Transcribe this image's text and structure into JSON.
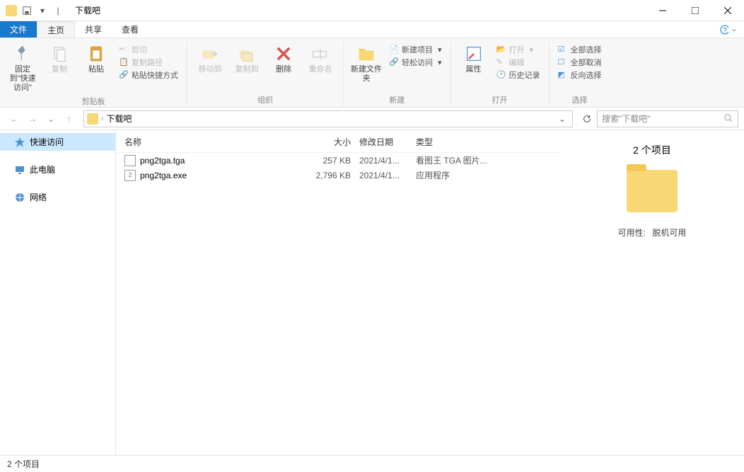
{
  "window": {
    "title": "下载吧"
  },
  "tabs": {
    "file": "文件",
    "home": "主页",
    "share": "共享",
    "view": "查看"
  },
  "ribbon": {
    "clipboard": {
      "pin": "固定到\"快速访问\"",
      "copy": "复制",
      "paste": "粘贴",
      "cut": "剪切",
      "copy_path": "复制路径",
      "paste_shortcut": "粘贴快捷方式",
      "label": "剪贴板"
    },
    "organize": {
      "move_to": "移动到",
      "copy_to": "复制到",
      "delete": "删除",
      "rename": "重命名",
      "label": "组织"
    },
    "new": {
      "new_folder": "新建文件夹",
      "new_item": "新建项目",
      "easy_access": "轻松访问",
      "label": "新建"
    },
    "open": {
      "properties": "属性",
      "open": "打开",
      "edit": "编辑",
      "history": "历史记录",
      "label": "打开"
    },
    "select": {
      "select_all": "全部选择",
      "select_none": "全部取消",
      "invert": "反向选择",
      "label": "选择"
    }
  },
  "address": {
    "path": "下载吧"
  },
  "search": {
    "placeholder": "搜索\"下载吧\""
  },
  "sidebar": {
    "quick": "快速访问",
    "pc": "此电脑",
    "network": "网络"
  },
  "columns": {
    "name": "名称",
    "size": "大小",
    "date": "修改日期",
    "type": "类型"
  },
  "files": [
    {
      "name": "png2tga.tga",
      "size": "257 KB",
      "date": "2021/4/1...",
      "type": "看图王 TGA 图片..."
    },
    {
      "name": "png2tga.exe",
      "size": "2,796 KB",
      "date": "2021/4/1...",
      "type": "应用程序"
    }
  ],
  "preview": {
    "count": "2 个项目",
    "availability_label": "可用性:",
    "availability_value": "脱机可用"
  },
  "status": {
    "text": "2 个项目"
  }
}
